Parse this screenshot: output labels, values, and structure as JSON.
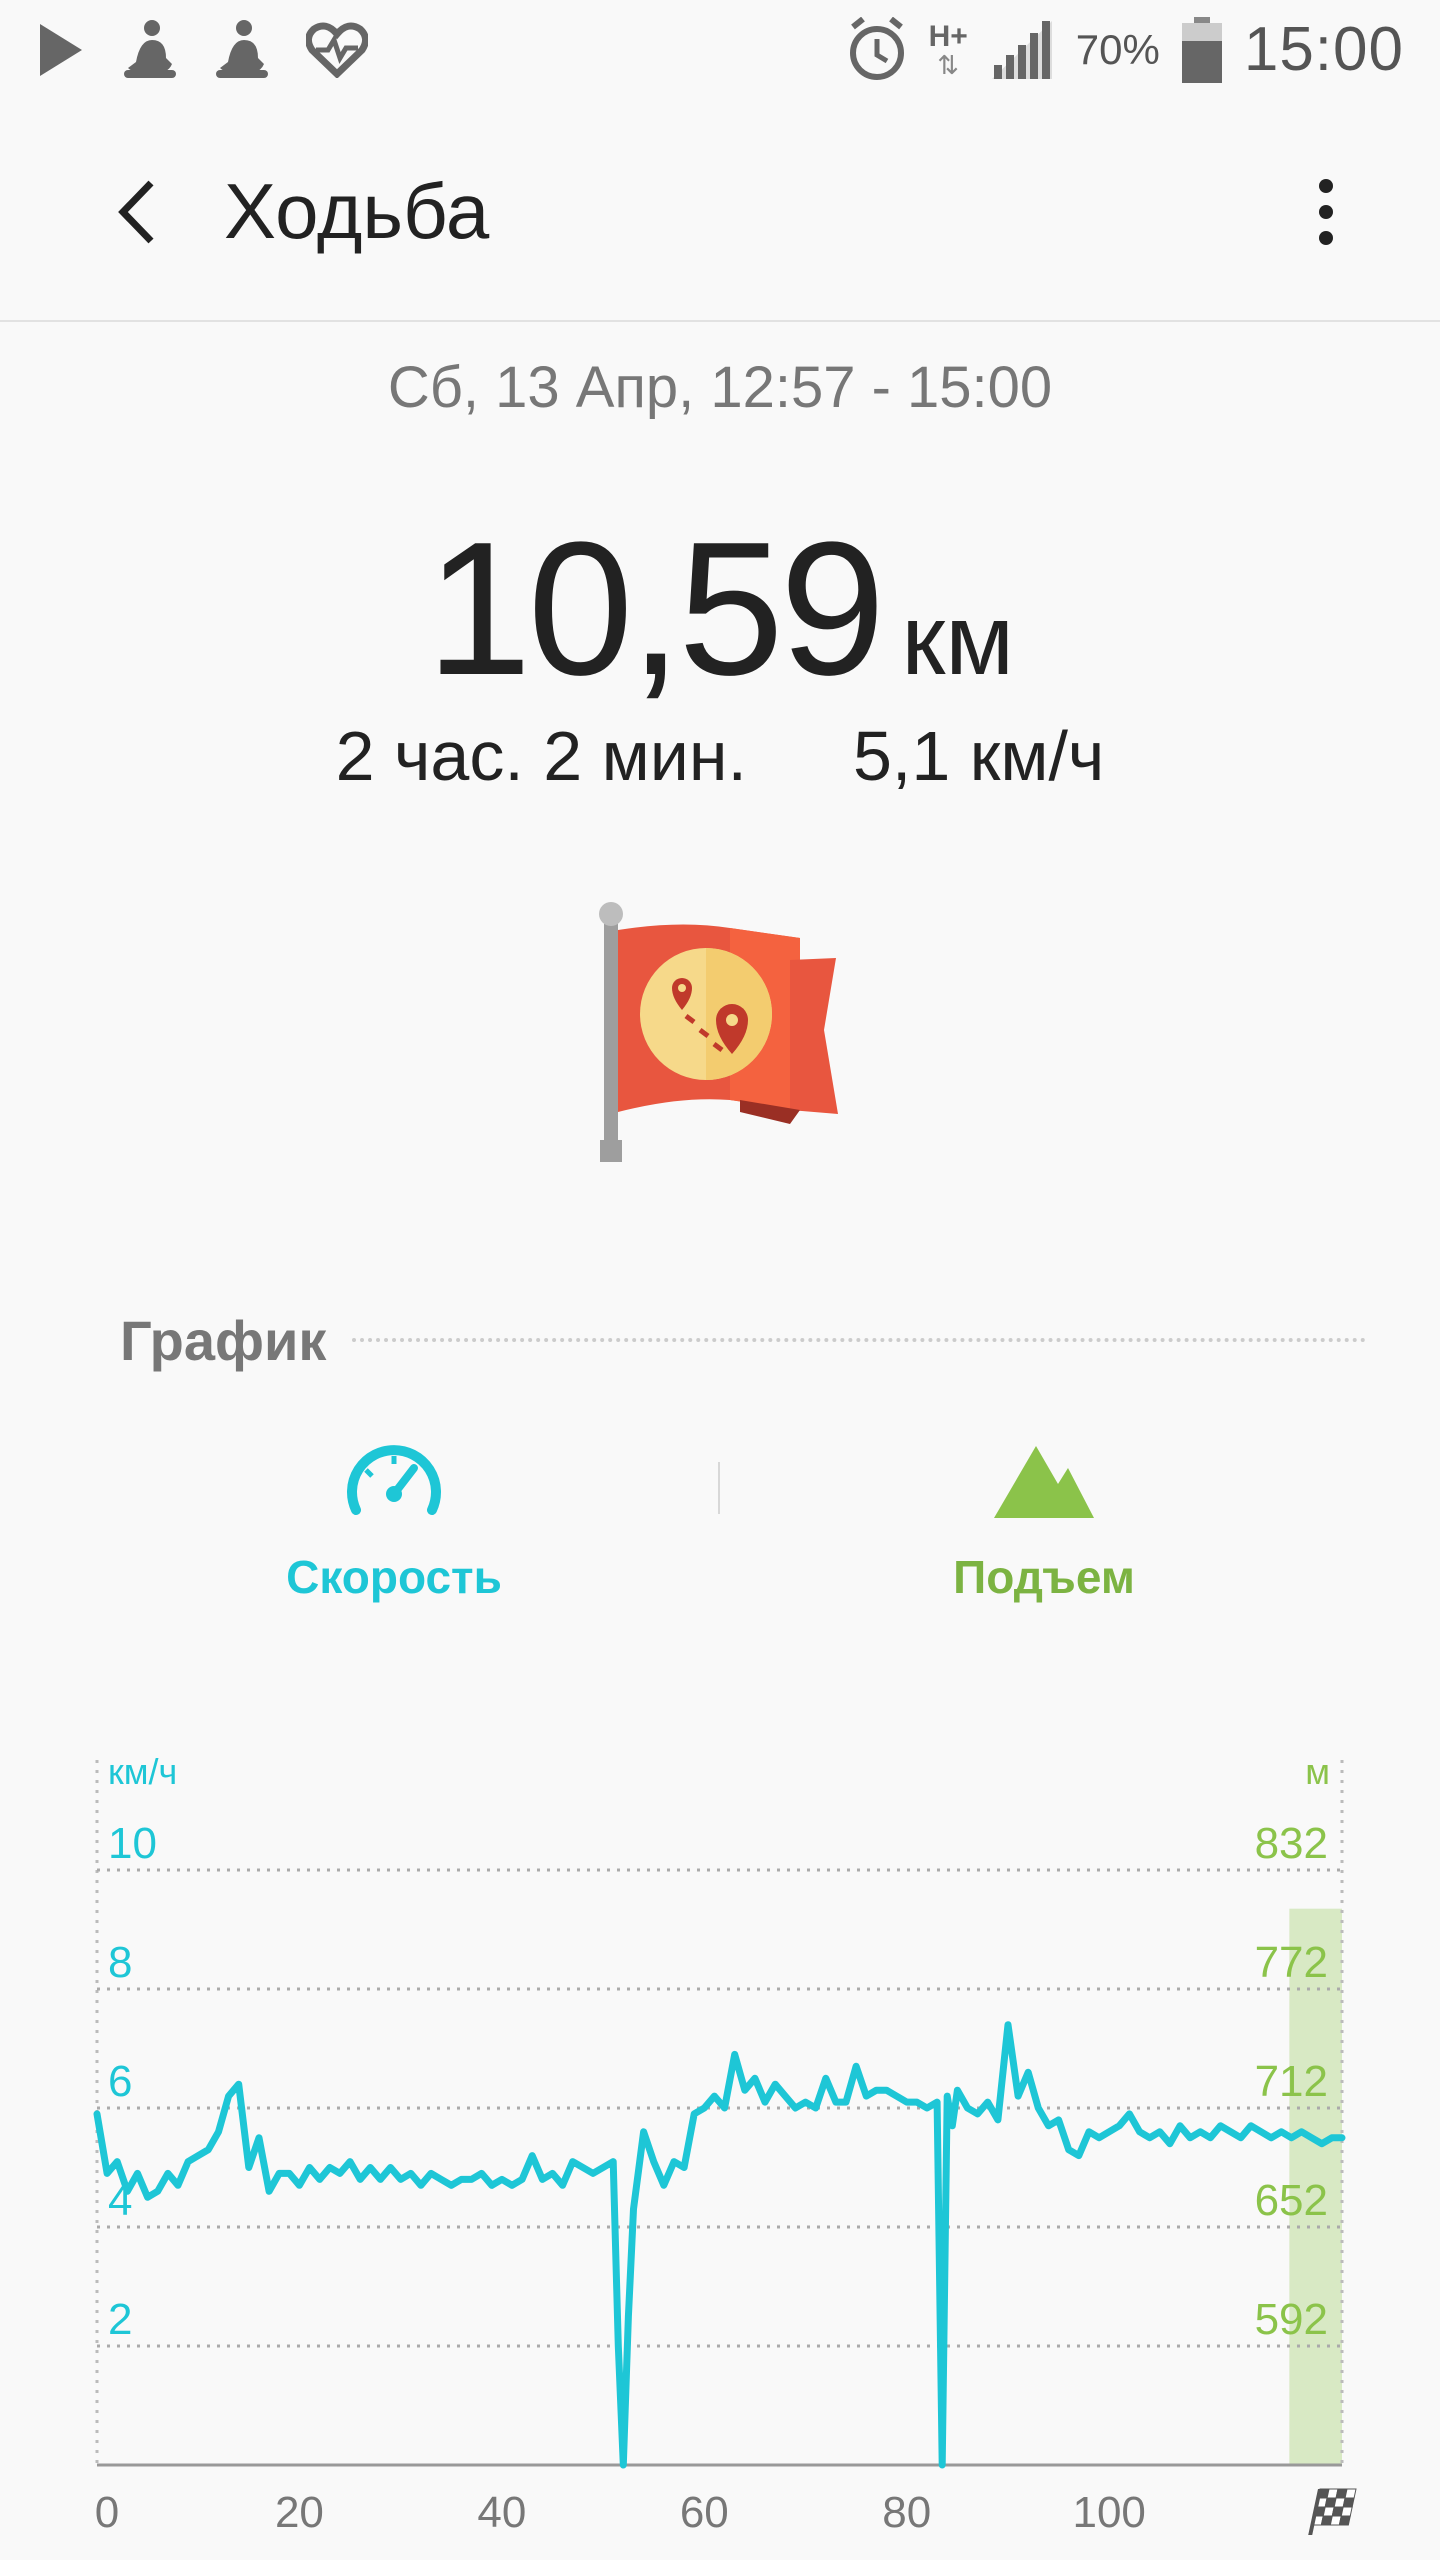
{
  "status_bar": {
    "network_type": "H+",
    "battery_percent": "70%",
    "time": "15:00",
    "icons": [
      "play-store-icon",
      "yoga-icon",
      "yoga-icon",
      "heart-icon",
      "alarm-icon",
      "signal-icon",
      "battery-icon"
    ]
  },
  "app_bar": {
    "title": "Ходьба",
    "back_icon": "chevron-left-icon",
    "menu_icon": "more-vert-icon"
  },
  "summary": {
    "date_range": "Сб, 13 Апр, 12:57 - 15:00",
    "distance_value": "10,59",
    "distance_unit": "км",
    "duration": "2 час. 2 мин.",
    "avg_speed": "5,1 км/ч",
    "achievement_icon": "map-flag-icon"
  },
  "chart_section": {
    "title": "График",
    "tabs": [
      {
        "label": "Скорость",
        "icon": "speedometer-icon",
        "color": "#1ec6d6"
      },
      {
        "label": "Подъем",
        "icon": "mountain-icon",
        "color": "#7cb342"
      }
    ]
  },
  "chart_data": {
    "type": "line",
    "speed_color": "#1ec6d6",
    "elevation_color": "#8bc34a",
    "left_axis_unit": "км/ч",
    "right_axis_unit": "м",
    "left_ticks": [
      "10",
      "8",
      "6",
      "4",
      "2"
    ],
    "left_tick_values": [
      10,
      8,
      6,
      4,
      2
    ],
    "right_ticks": [
      "832",
      "772",
      "712",
      "652",
      "592"
    ],
    "x_ticks": [
      "0",
      "20",
      "40",
      "60",
      "80",
      "100"
    ],
    "x_tick_values": [
      0,
      20,
      40,
      60,
      80,
      100
    ],
    "x_max": 123,
    "ylim": [
      0,
      10.5
    ],
    "grid": true,
    "finish_icon": "checkered-flag-icon",
    "highlight_range": [
      117.8,
      123
    ],
    "series": [
      {
        "name": "Скорость",
        "x": [
          0,
          1,
          2,
          3,
          4,
          5,
          6,
          7,
          8,
          9,
          10,
          11,
          12,
          13,
          14,
          15,
          16,
          17,
          18,
          19,
          20,
          21,
          22,
          23,
          24,
          25,
          26,
          27,
          28,
          29,
          30,
          31,
          32,
          33,
          34,
          35,
          36,
          37,
          38,
          39,
          40,
          41,
          42,
          43,
          44,
          45,
          46,
          47,
          48,
          49,
          50,
          51,
          51.5,
          52,
          52.5,
          53,
          54,
          55,
          56,
          57,
          58,
          59,
          60,
          61,
          62,
          63,
          64,
          65,
          66,
          67,
          68,
          69,
          70,
          71,
          72,
          73,
          74,
          75,
          76,
          77,
          78,
          79,
          80,
          81,
          82,
          83,
          83.5,
          84,
          84.5,
          85,
          86,
          87,
          88,
          89,
          90,
          91,
          92,
          93,
          94,
          95,
          96,
          97,
          98,
          99,
          100,
          101,
          102,
          103,
          104,
          105,
          106,
          107,
          108,
          109,
          110,
          111,
          112,
          113,
          114,
          115,
          116,
          117,
          118,
          119,
          120,
          121,
          122,
          123
        ],
        "values": [
          5.9,
          4.9,
          5.1,
          4.6,
          4.9,
          4.5,
          4.6,
          4.9,
          4.7,
          5.1,
          5.2,
          5.3,
          5.6,
          6.2,
          6.4,
          5.0,
          5.5,
          4.6,
          4.9,
          4.9,
          4.7,
          5.0,
          4.8,
          5.0,
          4.9,
          5.1,
          4.8,
          5.0,
          4.8,
          5.0,
          4.8,
          4.9,
          4.7,
          4.9,
          4.8,
          4.7,
          4.8,
          4.8,
          4.9,
          4.7,
          4.8,
          4.7,
          4.8,
          5.2,
          4.8,
          4.9,
          4.7,
          5.1,
          5.0,
          4.9,
          5.0,
          5.1,
          2.0,
          0.0,
          2.5,
          4.3,
          5.6,
          5.1,
          4.7,
          5.1,
          5.0,
          5.9,
          6.0,
          6.2,
          6.0,
          6.9,
          6.3,
          6.5,
          6.1,
          6.4,
          6.2,
          6.0,
          6.1,
          6.0,
          6.5,
          6.1,
          6.1,
          6.7,
          6.2,
          6.3,
          6.3,
          6.2,
          6.1,
          6.1,
          6.0,
          6.1,
          0.0,
          6.2,
          5.7,
          6.3,
          6.0,
          5.9,
          6.1,
          5.8,
          7.4,
          6.2,
          6.6,
          6.0,
          5.7,
          5.8,
          5.3,
          5.2,
          5.6,
          5.5,
          5.6,
          5.7,
          5.9,
          5.6,
          5.5,
          5.6,
          5.4,
          5.7,
          5.5,
          5.6,
          5.5,
          5.7,
          5.6,
          5.5,
          5.7,
          5.6,
          5.5,
          5.6,
          5.5,
          5.6,
          5.5,
          5.4,
          5.5,
          5.5
        ]
      }
    ]
  }
}
